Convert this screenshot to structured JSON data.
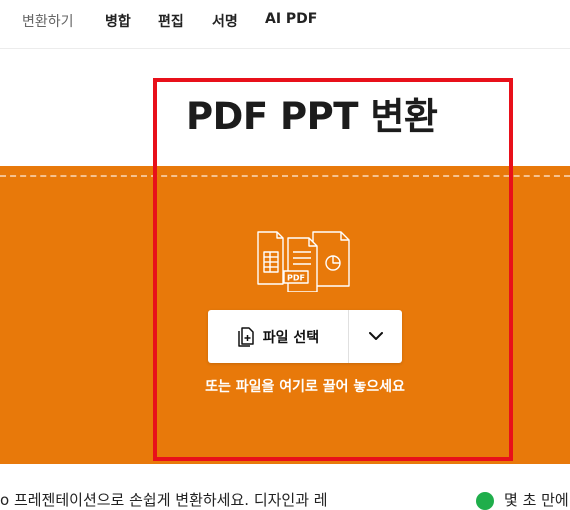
{
  "nav": {
    "items": [
      "변환하기",
      "병합",
      "편집",
      "서명",
      "AI PDF"
    ]
  },
  "page": {
    "title": "PDF PPT 변환"
  },
  "upload": {
    "select_label": "파일 선택",
    "drop_hint": "또는 파일을 여기로 끌어 놓으세요",
    "icon_badge": "PDF"
  },
  "footer": {
    "text": "o 프레젠테이션으로 손쉽게 변환하세요. 디자인과 레",
    "right_text": "몇 초 만에"
  },
  "colors": {
    "accent": "#e8790a",
    "highlight": "#e8101a",
    "check": "#1fae4b"
  }
}
